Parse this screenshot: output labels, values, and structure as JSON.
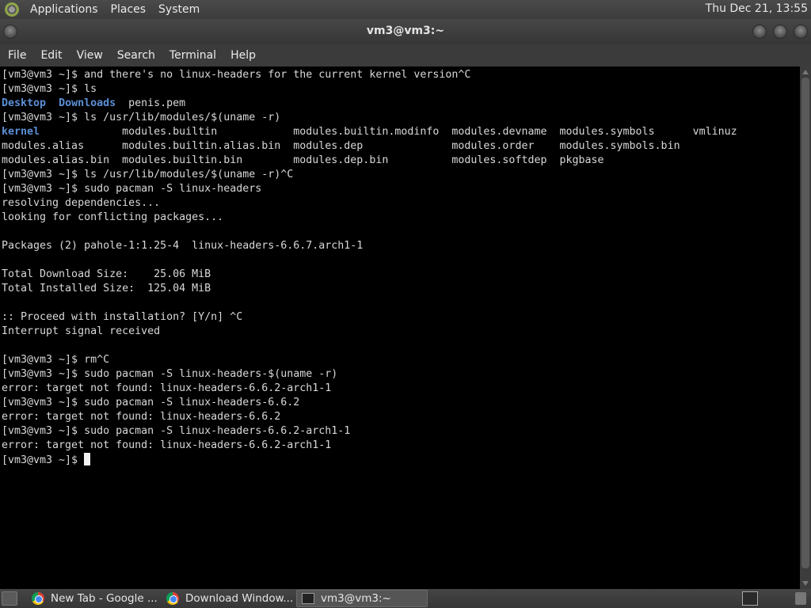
{
  "top_panel": {
    "menus": [
      "Applications",
      "Places",
      "System"
    ],
    "clock": "Thu Dec 21, 13:55"
  },
  "window": {
    "title": "vm3@vm3:~"
  },
  "menubar": {
    "items": [
      "File",
      "Edit",
      "View",
      "Search",
      "Terminal",
      "Help"
    ]
  },
  "terminal": {
    "lines": [
      "[vm3@vm3 ~]$ and there's no linux-headers for the current kernel version^C",
      "[vm3@vm3 ~]$ ls",
      {
        "segments": [
          {
            "text": "Desktop",
            "color": "blue"
          },
          {
            "text": "  "
          },
          {
            "text": "Downloads",
            "color": "blue"
          },
          {
            "text": "  penis.pem"
          }
        ]
      },
      "[vm3@vm3 ~]$ ls /usr/lib/modules/$(uname -r)",
      {
        "segments": [
          {
            "text": "kernel",
            "color": "blue"
          },
          {
            "text": "             modules.builtin            modules.builtin.modinfo  modules.devname  modules.symbols      vmlinuz"
          }
        ]
      },
      "modules.alias      modules.builtin.alias.bin  modules.dep              modules.order    modules.symbols.bin",
      "modules.alias.bin  modules.builtin.bin        modules.dep.bin          modules.softdep  pkgbase",
      "[vm3@vm3 ~]$ ls /usr/lib/modules/$(uname -r)^C",
      "[vm3@vm3 ~]$ sudo pacman -S linux-headers",
      "resolving dependencies...",
      "looking for conflicting packages...",
      "",
      "Packages (2) pahole-1:1.25-4  linux-headers-6.6.7.arch1-1",
      "",
      "Total Download Size:    25.06 MiB",
      "Total Installed Size:  125.04 MiB",
      "",
      ":: Proceed with installation? [Y/n] ^C",
      "Interrupt signal received",
      "",
      "[vm3@vm3 ~]$ rm^C",
      "[vm3@vm3 ~]$ sudo pacman -S linux-headers-$(uname -r)",
      "error: target not found: linux-headers-6.6.2-arch1-1",
      "[vm3@vm3 ~]$ sudo pacman -S linux-headers-6.6.2",
      "error: target not found: linux-headers-6.6.2",
      "[vm3@vm3 ~]$ sudo pacman -S linux-headers-6.6.2-arch1-1",
      "error: target not found: linux-headers-6.6.2-arch1-1"
    ],
    "prompt": "[vm3@vm3 ~]$ "
  },
  "taskbar": {
    "tasks": [
      {
        "label": "New Tab - Google ...",
        "icon": "chrome-icon",
        "active": false
      },
      {
        "label": "Download Window...",
        "icon": "chrome-icon",
        "active": false
      },
      {
        "label": "vm3@vm3:~",
        "icon": "terminal-icon",
        "active": true
      }
    ]
  },
  "colors": {
    "terminal_bg": "#000000",
    "terminal_fg": "#d8d8d8",
    "directory_blue": "#5b8fd6",
    "panel_bg": "#3c3c3c"
  }
}
